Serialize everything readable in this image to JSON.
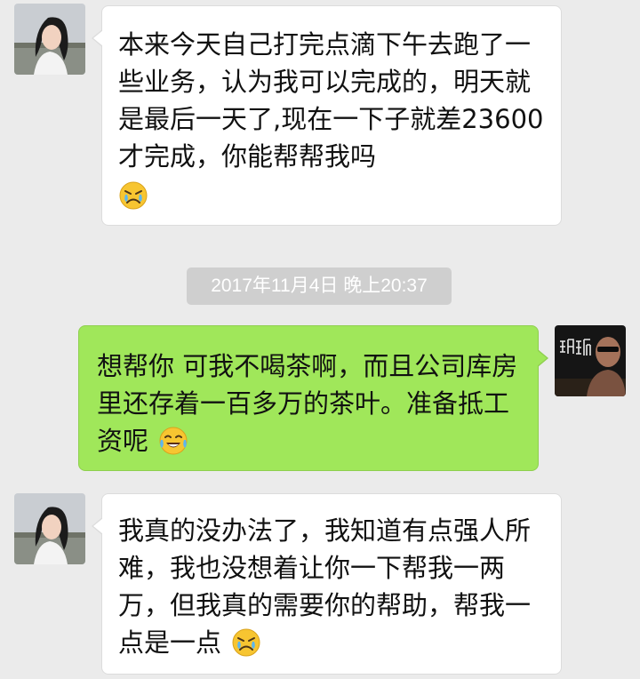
{
  "messages": [
    {
      "sender": "contact",
      "text": "本来今天自己打完点滴下午去跑了一些业务，认为我可以完成的，明天就是最后一天了,现在一下子就差23600才完成，你能帮帮我吗",
      "emoji": "crying-face-emoji"
    },
    {
      "sender": "self",
      "text": "想帮你 可我不喝茶啊，而且公司库房里还存着一百多万的茶叶。准备抵工资呢",
      "emoji": "laughing-tears-emoji"
    },
    {
      "sender": "contact",
      "text": "我真的没办法了，我知道有点强人所难，我也没想着让你一下帮我一两万，但我真的需要你的帮助，帮我一点是一点",
      "emoji": "crying-face-emoji"
    }
  ],
  "timestamp": "2017年11月4日 晚上20:37",
  "colors": {
    "background": "#ebebeb",
    "incoming_bubble": "#ffffff",
    "outgoing_bubble": "#a0e75a",
    "timestamp_bg": "#cfcfcf"
  }
}
